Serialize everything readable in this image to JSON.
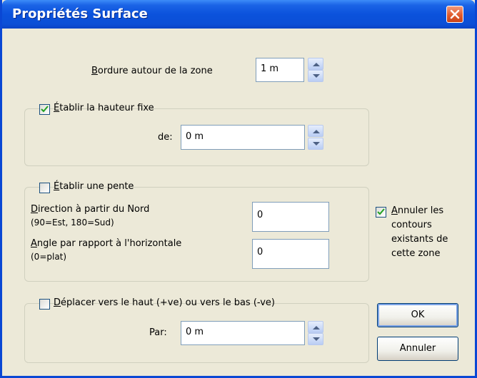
{
  "window": {
    "title": "Propriétés Surface"
  },
  "border": {
    "label_u": "B",
    "label_rest": "ordure autour de la zone",
    "value": "1 m"
  },
  "fixed_height": {
    "checked": true,
    "label_u": "É",
    "label_rest": "tablir la hauteur fixe",
    "de_label": "de:",
    "de_value": "0 m"
  },
  "slope": {
    "checked": false,
    "label_u": "É",
    "label_rest": "tablir une pente",
    "direction_u": "D",
    "direction_rest": "irection à partir du Nord",
    "direction_hint": "(90=Est, 180=Sud)",
    "direction_value": "0",
    "angle_u": "A",
    "angle_rest": "ngle par rapport à l'horizontale",
    "angle_hint": "(0=plat)",
    "angle_value": "0"
  },
  "cancel_contours": {
    "checked": true,
    "line1_u": "A",
    "line1_rest": "nnuler les",
    "line2": "contours",
    "line3": "existants de",
    "line4": "cette zone"
  },
  "move": {
    "checked": false,
    "label_u": "D",
    "label_rest": "éplacer vers le haut (+ve)  ou vers le bas (-ve)",
    "par_label": "Par:",
    "par_value": "0 m"
  },
  "buttons": {
    "ok": "OK",
    "cancel": "Annuler"
  },
  "icons": {
    "close": "close-icon",
    "check": "check-icon",
    "spin_up": "up-arrow-icon",
    "spin_down": "down-arrow-icon"
  }
}
